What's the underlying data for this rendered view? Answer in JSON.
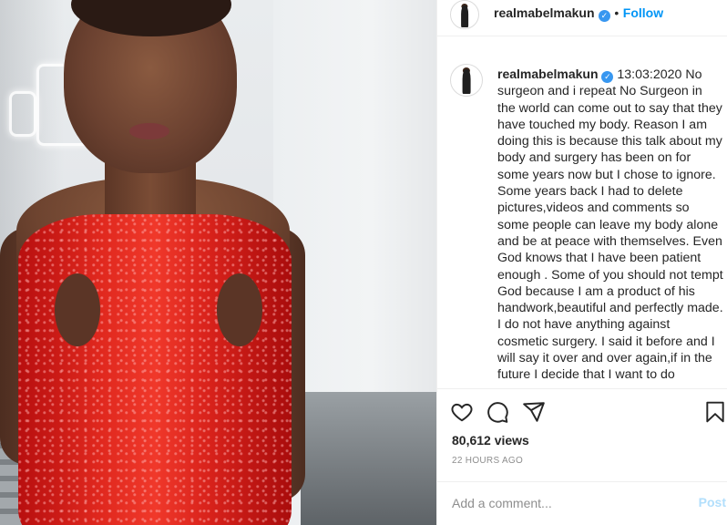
{
  "post": {
    "username": "realmabelmakun",
    "verified_icon": "verified-badge-icon",
    "separator": "•",
    "follow_label": "Follow",
    "caption": "13:03:2020 No surgeon and i repeat No Surgeon in the world can come out to say that they have touched my body. Reason I am doing this is because this talk about my body and surgery has been on for some years now but I chose to ignore. Some years back I had to delete pictures,videos and comments so some people can leave my body alone and be at peace with themselves. Even God knows that I have been patient enough . Some of you should not tempt God because I am a product of his handwork,beautiful and perfectly made. I do not have anything against cosmetic surgery. I said it before and I will say it over and over again,if in the future I decide that I want to do",
    "views": "80,612 views",
    "timestamp": "22 HOURS AGO"
  },
  "actions": {
    "like_icon": "heart-icon",
    "comment_icon": "comment-icon",
    "share_icon": "share-icon",
    "save_icon": "bookmark-icon"
  },
  "comment": {
    "placeholder": "Add a comment...",
    "post_label": "Post"
  },
  "colors": {
    "accent": "#0095f6",
    "post_disabled": "#b2dffc",
    "verified": "#3897f0",
    "muted": "#8e8e8e",
    "dress_red": "#e0281e"
  }
}
